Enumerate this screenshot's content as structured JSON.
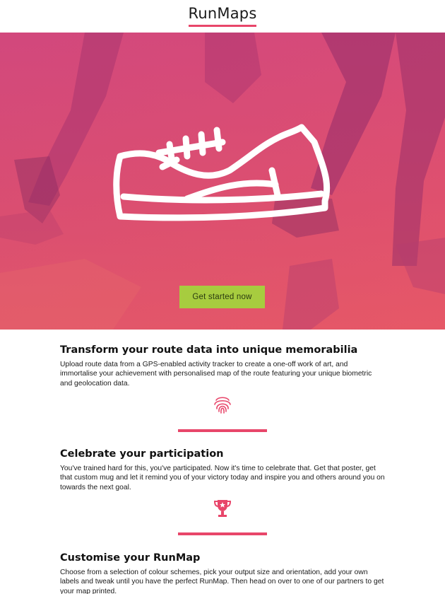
{
  "header": {
    "logo": "RunMaps"
  },
  "hero": {
    "cta_label": "Get started now"
  },
  "sections": [
    {
      "title": "Transform your route data into unique memorabilia",
      "body": "Upload route data from a GPS-enabled activity tracker to create a one-off work of art, and immortalise your achievement with personalised map of the route featuring your unique biometric and geolocation data.",
      "icon": "fingerprint-icon"
    },
    {
      "title": "Celebrate your participation",
      "body": "You've trained hard for this, you've participated. Now it's time to celebrate that. Get that poster, get that custom mug and let it remind you of your victory today and inspire you and others around you on towards the next goal.",
      "icon": "trophy-icon"
    },
    {
      "title": "Customise your RunMap",
      "body": "Choose from a selection of colour schemes, pick your output size and orientation, add your own labels and tweak until you have the perfect RunMap. Then head on over to one of our partners to get your map printed."
    }
  ],
  "colors": {
    "accent": "#e8466a",
    "cta": "#a7cc3f",
    "hero": "#e0506f"
  }
}
